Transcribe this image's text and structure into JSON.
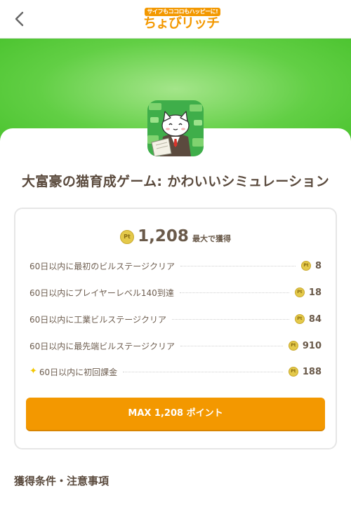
{
  "header": {
    "back_icon": "chevron-left-icon",
    "logo": {
      "tagline": "サイフもココロもハッピーに!",
      "name": "ちょびリッチ",
      "color": "#f39800"
    }
  },
  "hero": {
    "colors": [
      "#a4e58a",
      "#48c22c"
    ]
  },
  "app": {
    "icon": "white-cat-businessman-icon",
    "title": "大富豪の猫育成ゲーム: かわいいシミュレーション"
  },
  "reward": {
    "coin_label": "Pt",
    "total_points": "1,208",
    "total_suffix": "最大で獲得",
    "tasks": [
      {
        "label": "60日以内に最初のビルステージクリア",
        "points": "8",
        "special": false
      },
      {
        "label": "60日以内にプレイヤーレベル140到達",
        "points": "18",
        "special": false
      },
      {
        "label": "60日以内に工業ビルステージクリア",
        "points": "84",
        "special": false
      },
      {
        "label": "60日以内に最先端ビルステージクリア",
        "points": "910",
        "special": false
      },
      {
        "label": "60日以内に初回課金",
        "points": "188",
        "special": true
      }
    ]
  },
  "cta": {
    "label": "MAX 1,208 ポイント",
    "color": "#f39800"
  },
  "section": {
    "conditions_title": "獲得条件・注意事項"
  }
}
